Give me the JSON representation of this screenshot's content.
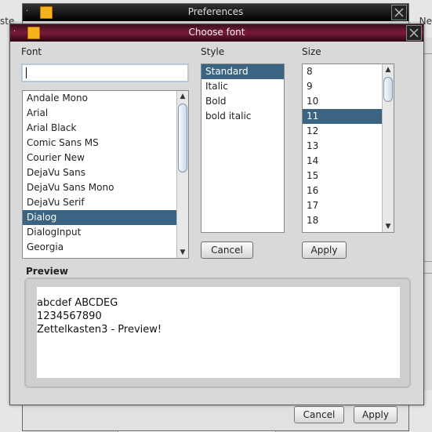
{
  "background": {
    "left_fragment": "ste",
    "right_fragment": "Ne"
  },
  "preferences": {
    "title": "Preferences",
    "cancel_label": "Cancel",
    "apply_label": "Apply"
  },
  "dialog": {
    "title": "Choose font",
    "font_label": "Font",
    "style_label": "Style",
    "size_label": "Size",
    "font_input_value": "",
    "fonts": [
      "Andale Mono",
      "Arial",
      "Arial Black",
      "Comic Sans MS",
      "Courier New",
      "DejaVu Sans",
      "DejaVu Sans Mono",
      "DejaVu Serif",
      "Dialog",
      "DialogInput",
      "Georgia"
    ],
    "selected_font": "Dialog",
    "styles": [
      "Standard",
      "Italic",
      "Bold",
      "bold italic"
    ],
    "selected_style": "Standard",
    "sizes": [
      "8",
      "9",
      "10",
      "11",
      "12",
      "13",
      "14",
      "15",
      "16",
      "17",
      "18"
    ],
    "selected_size": "11",
    "cancel_label": "Cancel",
    "apply_label": "Apply",
    "preview_label": "Preview",
    "preview_lines": [
      "abcdef ABCDEG",
      "1234567890",
      "Zettelkasten3 - Preview!"
    ]
  },
  "colors": {
    "selection": "#3b6482",
    "title_accent": "#7a1a3a",
    "note_icon": "#f6b21c"
  }
}
